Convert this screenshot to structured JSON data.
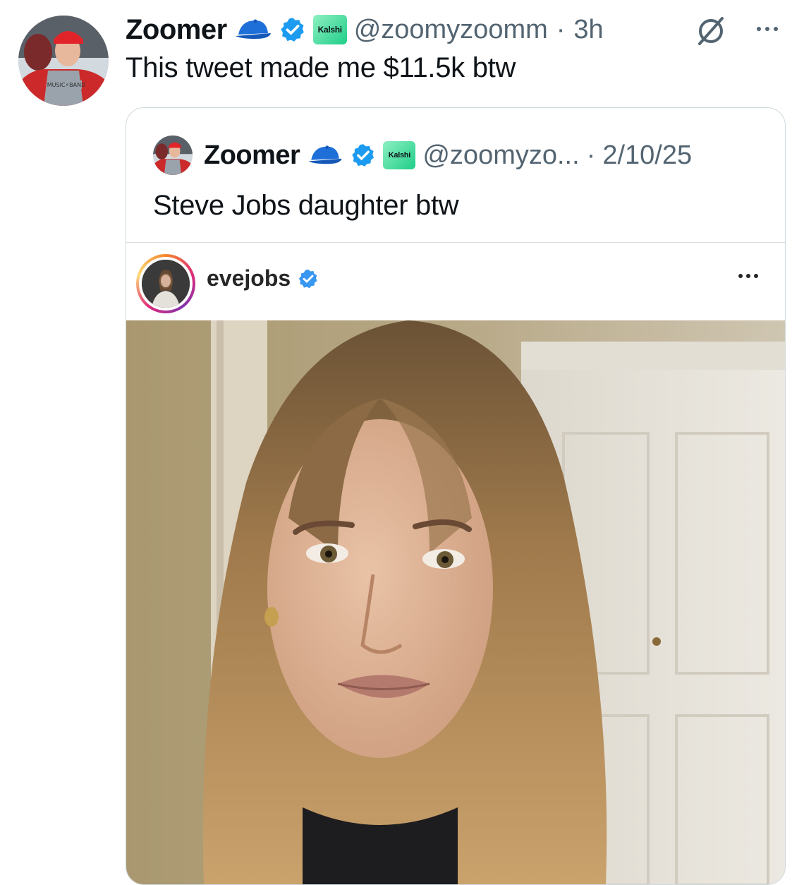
{
  "tweet": {
    "author_name": "Zoomer",
    "handle": "@zoomyzoomm",
    "separator": "·",
    "time": "3h",
    "badge_label": "Kalshi",
    "text": "This tweet made me $11.5k btw",
    "avatar_shirt_text": "MUSIC⚡BAND"
  },
  "quoted_tweet": {
    "author_name": "Zoomer",
    "handle": "@zoomyzo...",
    "separator": "·",
    "date": "2/10/25",
    "badge_label": "Kalshi",
    "text": "Steve Jobs daughter btw"
  },
  "instagram_post": {
    "username": "evejobs"
  },
  "icons": {
    "cap": "cap-emoji-icon",
    "verified": "verified-badge-icon",
    "kalshi": "kalshi-logo-icon",
    "grok": "grok-icon",
    "more": "more-options-icon",
    "ig_verified": "instagram-verified-icon"
  },
  "colors": {
    "verified_blue": "#1d9bf0",
    "text_primary": "#0f1419",
    "text_secondary": "#536471",
    "kalshi_green": "#1fce8a",
    "border": "#cfd9de"
  }
}
